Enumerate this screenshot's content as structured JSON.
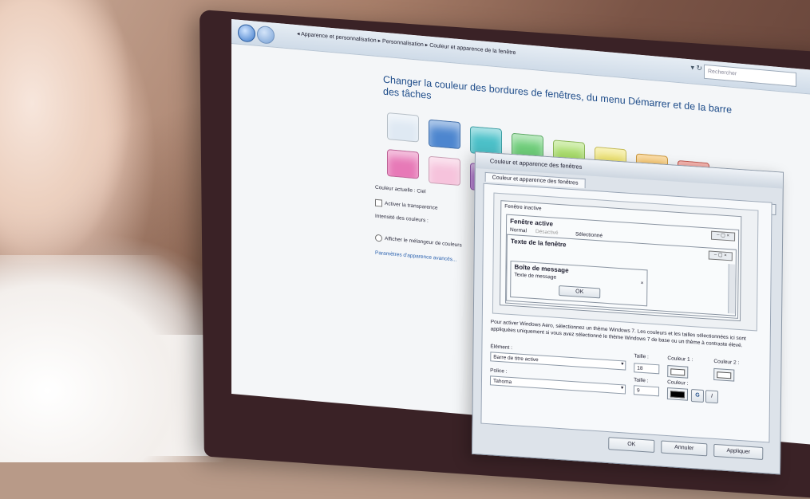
{
  "explorer": {
    "breadcrumb": "◂ Apparence et personnalisation ▸ Personnalisation ▸ Couleur et apparence de la fenêtre",
    "search_placeholder": "Rechercher",
    "title": "Changer la couleur des bordures de fenêtres, du menu Démarrer et de la barre des tâches",
    "current_color": "Couleur actuelle : Ciel",
    "transparency_label": "Activer la transparence",
    "intensity_label": "Intensité des couleurs :",
    "mixer_label": "Afficher le mélangeur de couleurs",
    "advanced_link": "Paramètres d'apparence avancés..."
  },
  "swatch_colors": [
    "#dfe9f3",
    "#4d86cf",
    "#4cc1c9",
    "#6fce7a",
    "#a9de6a",
    "#efe36a",
    "#f6b94c",
    "#ea6a5f",
    "#e779b7",
    "#f6c3dc",
    "#b06ed2"
  ],
  "dialog": {
    "title": "Couleur et apparence des fenêtres",
    "tab": "Couleur et apparence des fenêtres",
    "close": "X",
    "preview": {
      "inactive": "Fenêtre inactive",
      "active": "Fenêtre active",
      "menu_normal": "Normal",
      "menu_disabled": "Désactivé",
      "menu_selected": "Sélectionné",
      "window_text": "Texte de la fenêtre",
      "msgbox_title": "Boîte de message",
      "msgbox_text": "Texte de message",
      "ok": "OK"
    },
    "description": "Pour activer Windows Aero, sélectionnez un thème Windows 7. Les couleurs et les tailles sélectionnées ici sont appliquées uniquement si vous avez sélectionné le thème Windows 7 de base ou un thème à contraste élevé.",
    "element_label": "Élément :",
    "element_value": "Barre de titre active",
    "size_label": "Taille :",
    "size_value": "18",
    "color1_label": "Couleur 1 :",
    "color2_label": "Couleur 2 :",
    "font_label": "Police :",
    "font_value": "Tahoma",
    "font_size_label": "Taille :",
    "font_size_value": "9",
    "font_color_label": "Couleur :",
    "bold_btn": "G",
    "italic_btn": "I",
    "ok_btn": "OK",
    "cancel_btn": "Annuler",
    "apply_btn": "Appliquer"
  }
}
